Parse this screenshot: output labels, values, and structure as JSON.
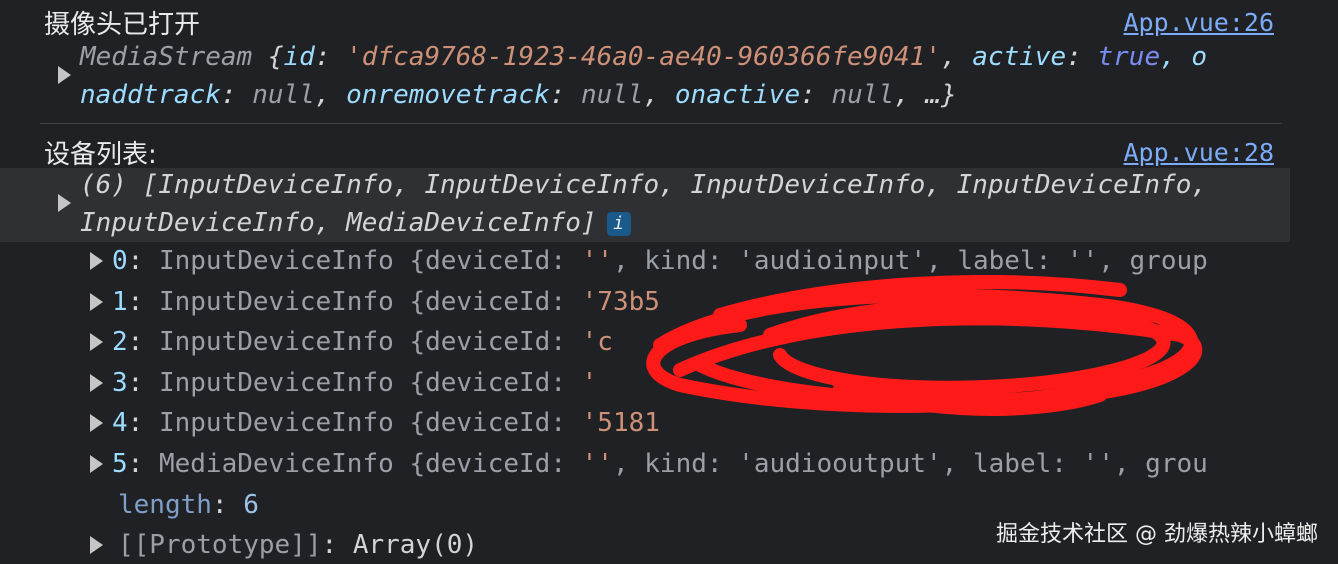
{
  "log1": {
    "message": "摄像头已打开",
    "source_link": "App.vue:26",
    "obj_line1": {
      "type": "MediaStream",
      "brace_open": " {",
      "id_key": "id",
      "id_value": "'dfca9768-1923-46a0-ae40-960366fe9041'",
      "active_key": "active",
      "active_value": "true",
      "trailing": ", o"
    },
    "obj_line2": {
      "k1": "naddtrack",
      "v1": "null",
      "k2": "onremovetrack",
      "v2": "null",
      "k3": "onactive",
      "v3": "null",
      "tail": ", …}"
    }
  },
  "log2": {
    "message": "设备列表:",
    "source_link": "App.vue:28",
    "summary_line1": "(6) [InputDeviceInfo, InputDeviceInfo, InputDeviceInfo, InputDeviceInfo,",
    "summary_line2": "InputDeviceInfo, MediaDeviceInfo]",
    "info_badge": "i",
    "items": [
      {
        "index": "0",
        "type": "InputDeviceInfo",
        "rest_key": "{deviceId:",
        "rest_val": "''",
        "rest_tail": ", kind: 'audioinput', label: '', group"
      },
      {
        "index": "1",
        "type": "InputDeviceInfo",
        "rest_key": "{deviceId:",
        "rest_val": "'73b5",
        "rest_tail": ""
      },
      {
        "index": "2",
        "type": "InputDeviceInfo",
        "rest_key": "{deviceId:",
        "rest_val": "'c",
        "rest_tail": ""
      },
      {
        "index": "3",
        "type": "InputDeviceInfo",
        "rest_key": "{deviceId:",
        "rest_val": "'",
        "rest_tail": ""
      },
      {
        "index": "4",
        "type": "InputDeviceInfo",
        "rest_key": "{deviceId:",
        "rest_val": "'5181",
        "rest_tail": ""
      },
      {
        "index": "5",
        "type": "MediaDeviceInfo",
        "rest_key": "{deviceId:",
        "rest_val": "''",
        "rest_tail": ", kind: 'audiooutput', label: '', grou"
      }
    ],
    "length_key": "length",
    "length_value": "6",
    "prototype_key": "[[Prototype]]",
    "prototype_value": "Array(0)"
  },
  "watermark": "掘金技术社区 @ 劲爆热辣小蟑螂",
  "colors": {
    "background": "#202124",
    "link": "#7cacf8",
    "string": "#ce9178",
    "key": "#9cdcfe",
    "boolean": "#7b8cf2",
    "scribble": "#ff1a1a"
  }
}
